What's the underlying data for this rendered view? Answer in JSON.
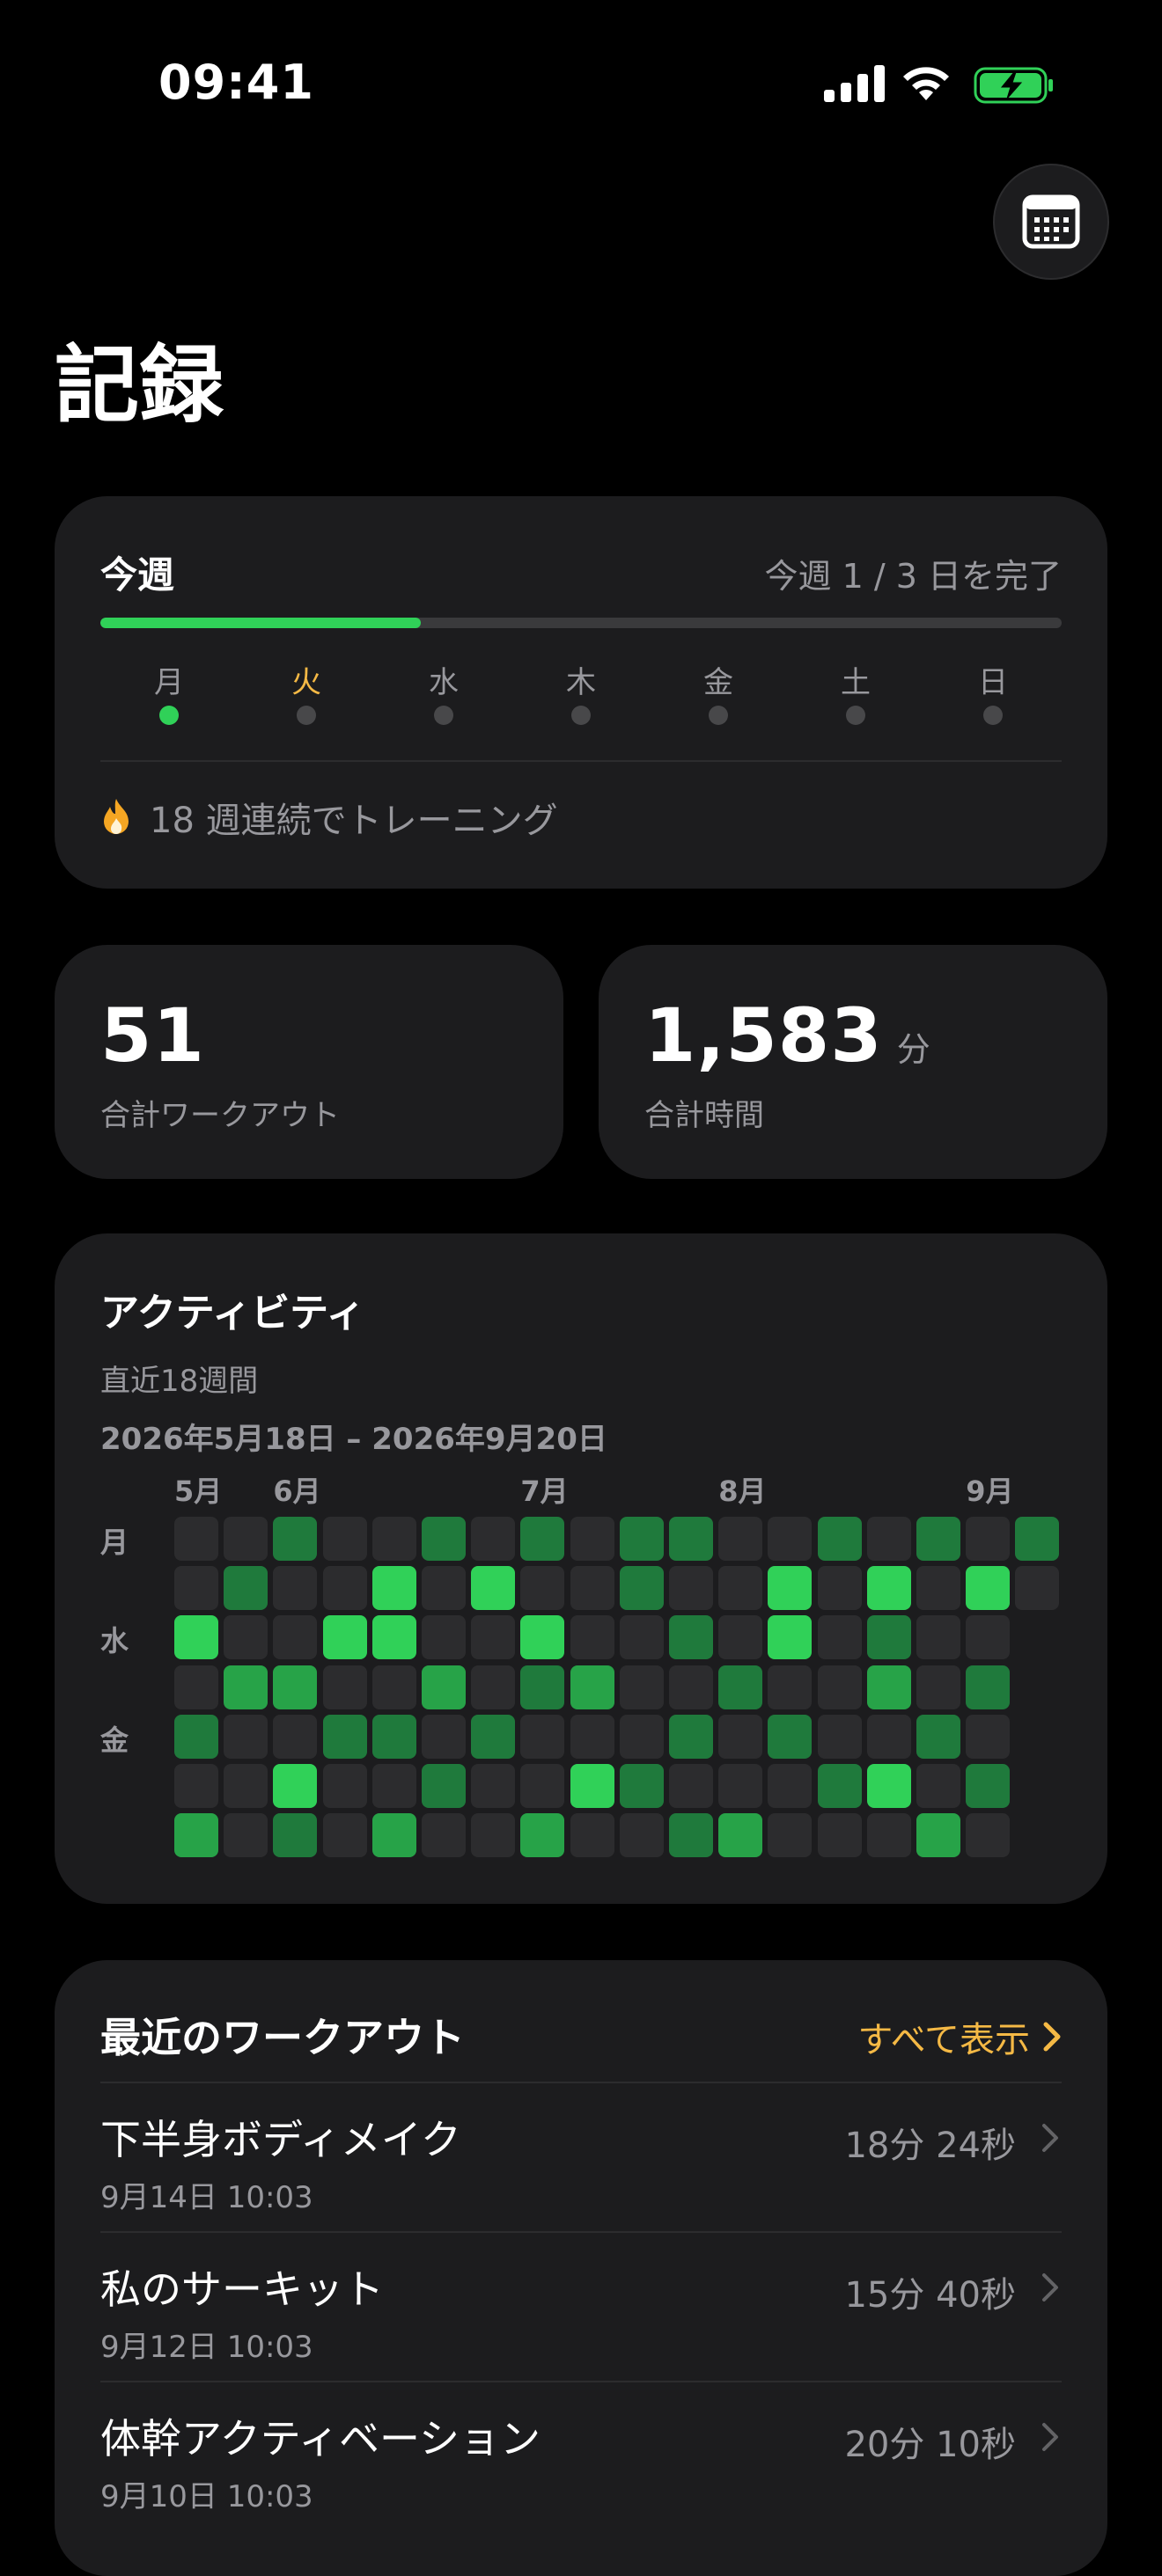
{
  "status_bar": {
    "time": "09:41"
  },
  "header": {
    "title": "記録",
    "calendar_icon": "calendar-icon"
  },
  "week": {
    "title": "今週",
    "status": "今週 1 / 3 日を完了",
    "progress": 0.333,
    "days": [
      {
        "label": "月",
        "done": true,
        "today": false
      },
      {
        "label": "火",
        "done": false,
        "today": true
      },
      {
        "label": "水",
        "done": false,
        "today": false
      },
      {
        "label": "木",
        "done": false,
        "today": false
      },
      {
        "label": "金",
        "done": false,
        "today": false
      },
      {
        "label": "土",
        "done": false,
        "today": false
      },
      {
        "label": "日",
        "done": false,
        "today": false
      }
    ],
    "streak": "18 週連続でトレーニング",
    "streak_icon": "flame-icon"
  },
  "stats": {
    "workouts_value": "51",
    "workouts_label": "合計ワークアウト",
    "time_value": "1,583",
    "time_unit": "分",
    "time_label": "合計時間"
  },
  "activity": {
    "title": "アクティビティ",
    "subtitle": "直近18週間",
    "range": "2026年5月18日 – 2026年9月20日",
    "months": [
      {
        "label": "5月",
        "col": 0
      },
      {
        "label": "6月",
        "col": 2
      },
      {
        "label": "7月",
        "col": 7
      },
      {
        "label": "8月",
        "col": 11
      },
      {
        "label": "9月",
        "col": 16
      }
    ],
    "row_labels": [
      {
        "label": "月",
        "row": 0
      },
      {
        "label": "水",
        "row": 2
      },
      {
        "label": "金",
        "row": 4
      }
    ],
    "colors": {
      "0": "#2c2c2e",
      "1": "#1f7a3c",
      "2": "#27a348",
      "3": "#30d158"
    },
    "grid": [
      [
        0,
        0,
        1,
        0,
        0,
        1,
        0,
        1,
        0,
        1,
        1,
        0,
        0,
        1,
        0,
        1,
        0,
        1
      ],
      [
        0,
        1,
        0,
        0,
        3,
        0,
        3,
        0,
        0,
        1,
        0,
        0,
        3,
        0,
        3,
        0,
        3,
        0
      ],
      [
        3,
        0,
        0,
        3,
        3,
        0,
        0,
        3,
        0,
        0,
        1,
        0,
        3,
        0,
        1,
        0,
        0
      ],
      [
        0,
        2,
        2,
        0,
        0,
        2,
        0,
        1,
        2,
        0,
        0,
        1,
        0,
        0,
        2,
        0,
        1
      ],
      [
        1,
        0,
        0,
        1,
        1,
        0,
        1,
        0,
        0,
        0,
        1,
        0,
        1,
        0,
        0,
        1,
        0
      ],
      [
        0,
        0,
        3,
        0,
        0,
        1,
        0,
        0,
        3,
        1,
        0,
        0,
        0,
        1,
        3,
        0,
        1
      ],
      [
        2,
        0,
        1,
        0,
        2,
        0,
        0,
        2,
        0,
        0,
        1,
        2,
        0,
        0,
        0,
        2,
        0
      ]
    ]
  },
  "recent": {
    "title": "最近のワークアウト",
    "see_all": "すべて表示",
    "items": [
      {
        "name": "下半身ボディメイク",
        "date": "9月14日 10:03",
        "duration": "18分 24秒"
      },
      {
        "name": "私のサーキット",
        "date": "9月12日 10:03",
        "duration": "15分 40秒"
      },
      {
        "name": "体幹アクティベーション",
        "date": "9月10日 10:03",
        "duration": "20分 10秒"
      }
    ]
  }
}
